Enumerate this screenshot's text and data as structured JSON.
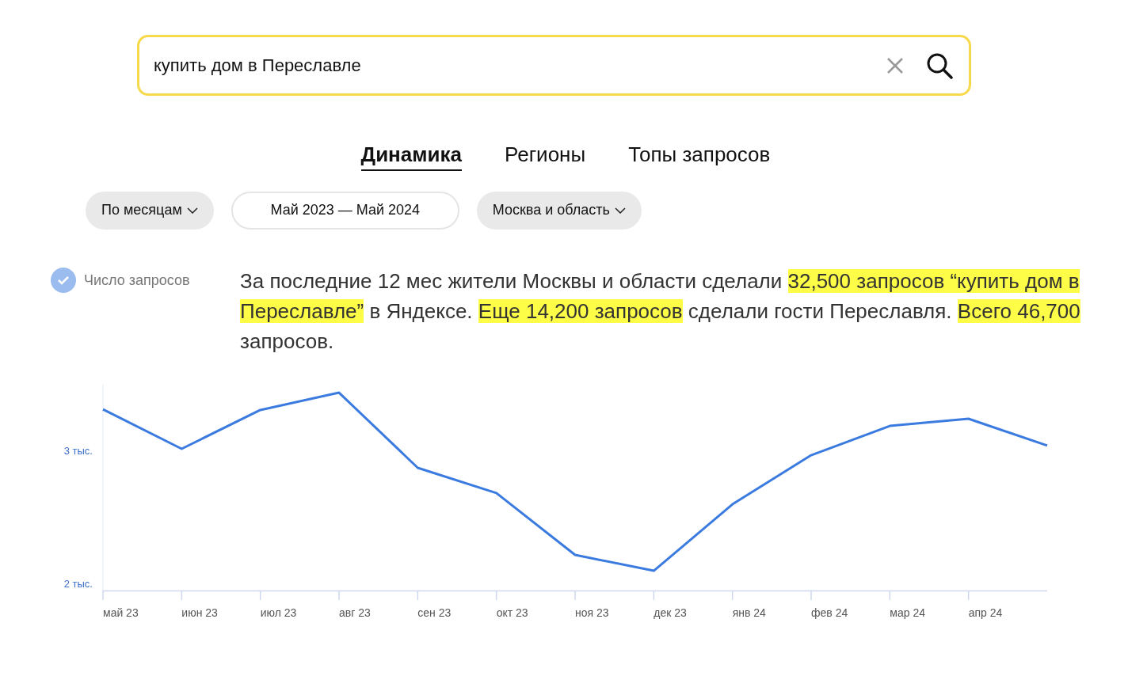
{
  "search": {
    "value": "купить дом в Переславле"
  },
  "tabs": [
    {
      "label": "Динамика",
      "selected": true
    },
    {
      "label": "Регионы",
      "selected": false
    },
    {
      "label": "Топы запросов",
      "selected": false
    }
  ],
  "filters": [
    {
      "kind": "dropdown",
      "label": "По месяцам"
    },
    {
      "kind": "range",
      "label": "Май 2023 — Май 2024"
    },
    {
      "kind": "dropdown",
      "label": "Москва и область"
    }
  ],
  "legend": {
    "checked": true
  },
  "summary": [
    {
      "text": "За последние 12 мес жители Москвы и области сделали ",
      "highlighted": false
    },
    {
      "text": "32,500 запросов “купить дом в Переславле”",
      "highlighted": true
    },
    {
      "text": " в Яндексе. ",
      "highlighted": false
    },
    {
      "text": "Еще 14,200 запросов",
      "highlighted": true
    },
    {
      "text": " сделали гости Переславля. ",
      "highlighted": false
    },
    {
      "text": "Всего 46,700",
      "highlighted": true
    },
    {
      "text": " запросов.",
      "highlighted": false
    }
  ],
  "chart_data": {
    "type": "line",
    "categories": [
      "май 23",
      "июн 23",
      "июл 23",
      "авг 23",
      "сен 23",
      "окт 23",
      "ноя 23",
      "дек 23",
      "янв 24",
      "фев 24",
      "мар 24",
      "апр 24",
      null
    ],
    "series": [
      {
        "name": "Число запросов",
        "color": "#3b7be0",
        "values": [
          3.315,
          3.018,
          3.31,
          3.44,
          2.875,
          2.685,
          2.22,
          2.101,
          2.601,
          2.97,
          3.19,
          3.244,
          3.042
        ]
      }
    ],
    "ylim": [
      1.95,
      3.5
    ],
    "yticks": [
      {
        "value": 2,
        "label": "2 тыс."
      },
      {
        "value": 3,
        "label": "3 тыс."
      }
    ]
  }
}
